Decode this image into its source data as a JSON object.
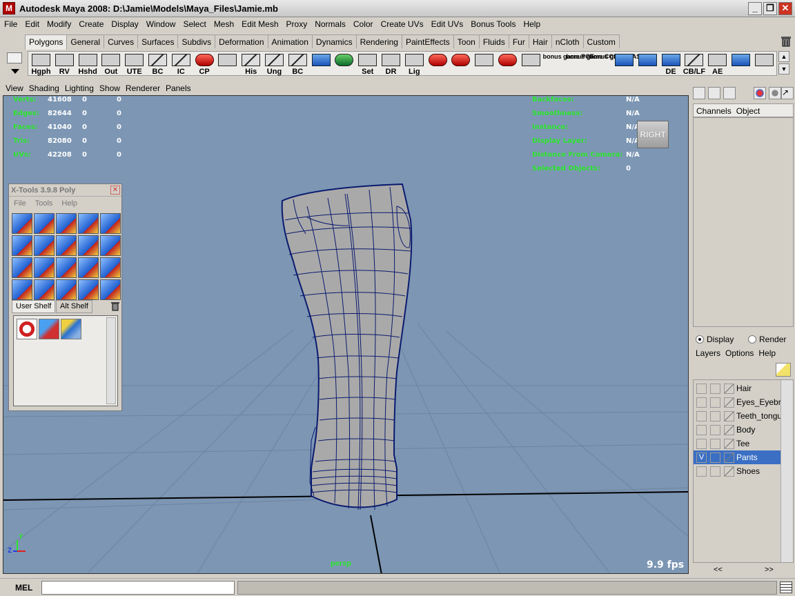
{
  "window": {
    "app_icon": "M",
    "title": "Autodesk Maya 2008: D:\\Jamie\\Models\\Maya_Files\\Jamie.mb",
    "controls": {
      "minimize": "_",
      "restore": "❐",
      "close": "✕"
    }
  },
  "menubar": [
    "File",
    "Edit",
    "Modify",
    "Create",
    "Display",
    "Window",
    "Select",
    "Mesh",
    "Edit Mesh",
    "Proxy",
    "Normals",
    "Color",
    "Create UVs",
    "Edit UVs",
    "Bonus Tools",
    "Help"
  ],
  "shelf_tabs": [
    "Polygons",
    "General",
    "Curves",
    "Surfaces",
    "Subdivs",
    "Deformation",
    "Animation",
    "Dynamics",
    "Rendering",
    "PaintEffects",
    "Toon",
    "Fluids",
    "Fur",
    "Hair",
    "nCloth",
    "Custom"
  ],
  "shelf_active_tab": "Polygons",
  "shelf_buttons": [
    {
      "label": "Hgph",
      "style": "plain"
    },
    {
      "label": "RV",
      "style": "plain"
    },
    {
      "label": "Hshd",
      "style": "plain"
    },
    {
      "label": "Out",
      "style": "plain"
    },
    {
      "label": "UTE",
      "style": "plain"
    },
    {
      "label": "BC",
      "style": "curve"
    },
    {
      "label": "IC",
      "style": "curve"
    },
    {
      "label": "CP",
      "style": "red"
    },
    {
      "label": "",
      "style": "plain"
    },
    {
      "label": "His",
      "style": "curve"
    },
    {
      "label": "Ung",
      "style": "curve"
    },
    {
      "label": "BC",
      "style": "curve"
    },
    {
      "label": "",
      "style": "blue"
    },
    {
      "label": "",
      "style": "green"
    },
    {
      "label": "Set",
      "style": "plain"
    },
    {
      "label": "DR",
      "style": "plain"
    },
    {
      "label": "Lig",
      "style": "plain"
    },
    {
      "label": "",
      "style": "red"
    },
    {
      "label": "",
      "style": "red"
    },
    {
      "label": "",
      "style": "plain"
    },
    {
      "label": "",
      "style": "red"
    },
    {
      "label": "",
      "style": "plain"
    },
    {
      "label": "bonus game PGT",
      "style": "stack"
    },
    {
      "label": "bonus game CCfE",
      "style": "stack"
    },
    {
      "label": "bonus game SAS",
      "style": "stack"
    },
    {
      "label": "",
      "style": "blue"
    },
    {
      "label": "",
      "style": "blue"
    },
    {
      "label": "DE",
      "style": "blue"
    },
    {
      "label": "CB/LF",
      "style": "curve"
    },
    {
      "label": "AE",
      "style": "plain"
    },
    {
      "label": "",
      "style": "blue"
    },
    {
      "label": "",
      "style": "plain"
    }
  ],
  "panel_menu": [
    "View",
    "Shading",
    "Lighting",
    "Show",
    "Renderer",
    "Panels"
  ],
  "hud_left": [
    {
      "label": "Verts:",
      "value": "41608",
      "a": "0",
      "b": "0"
    },
    {
      "label": "Edges:",
      "value": "82644",
      "a": "0",
      "b": "0"
    },
    {
      "label": "Faces:",
      "value": "41040",
      "a": "0",
      "b": "0"
    },
    {
      "label": "Tris:",
      "value": "82080",
      "a": "0",
      "b": "0"
    },
    {
      "label": "UVs:",
      "value": "42208",
      "a": "0",
      "b": "0"
    }
  ],
  "hud_right": [
    {
      "label": "Backfaces:",
      "value": "N/A"
    },
    {
      "label": "Smoothness:",
      "value": "N/A"
    },
    {
      "label": "Instance:",
      "value": "N/A"
    },
    {
      "label": "Display Layer:",
      "value": "N/A"
    },
    {
      "label": "Distance From Camera:",
      "value": "N/A"
    },
    {
      "label": "Selected Objects:",
      "value": "0"
    }
  ],
  "viewcube_label": "RIGHT",
  "camera_label": "persp",
  "fps": "9.9 fps",
  "axis": {
    "y": "Y",
    "z": "Z"
  },
  "xtools": {
    "title": "X-Tools 3.9.8 Poly",
    "close": "✕",
    "menu": [
      "File",
      "Tools",
      "Help"
    ],
    "tabs": [
      "User Shelf",
      "Alt Shelf"
    ]
  },
  "channel_box": {
    "menu": [
      "Channels",
      "Object"
    ]
  },
  "layer_editor": {
    "modes": [
      "Display",
      "Render"
    ],
    "active_mode": "Display",
    "menu": [
      "Layers",
      "Options",
      "Help"
    ],
    "layers": [
      {
        "name": "Hair",
        "visible": "",
        "selected": false
      },
      {
        "name": "Eyes_Eyebro",
        "visible": "",
        "selected": false
      },
      {
        "name": "Teeth_tongu",
        "visible": "",
        "selected": false
      },
      {
        "name": "Body",
        "visible": "",
        "selected": false
      },
      {
        "name": "Tee",
        "visible": "",
        "selected": false
      },
      {
        "name": "Pants",
        "visible": "V",
        "selected": true
      },
      {
        "name": "Shoes",
        "visible": "",
        "selected": false
      }
    ],
    "nav_prev": "<<",
    "nav_next": ">>"
  },
  "command_line": {
    "label": "MEL",
    "input": "",
    "output": ""
  },
  "colors": {
    "viewport_bg": "#7c96b4",
    "hud_green": "#2ee62e",
    "selection_blue": "#3a6fc4",
    "wireframe": "#0a1a6e",
    "mesh_gray": "#a9a9a9"
  }
}
